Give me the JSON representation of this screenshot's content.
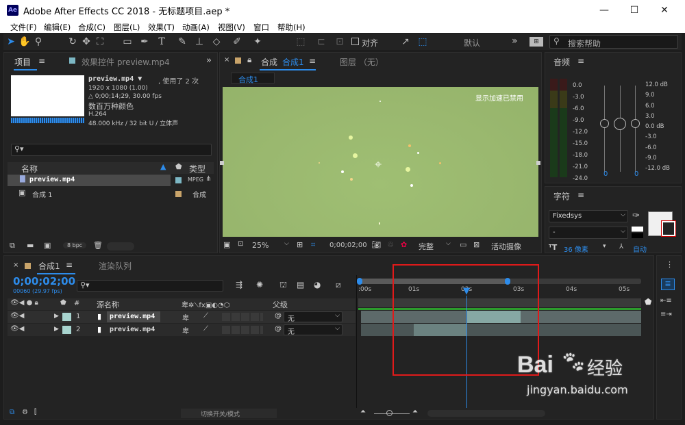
{
  "window": {
    "app_badge": "Ae",
    "title": "Adobe After Effects CC 2018 - 无标题项目.aep *",
    "min": "—",
    "max": "☐",
    "close": "✕"
  },
  "menu": [
    "文件(F)",
    "编辑(E)",
    "合成(C)",
    "图层(L)",
    "效果(T)",
    "动画(A)",
    "视图(V)",
    "窗口",
    "帮助(H)"
  ],
  "toolbar": {
    "snap_label": "对齐",
    "workspace": "默认",
    "search_placeholder": "搜索帮助",
    "more": "»"
  },
  "project": {
    "tab": "项目",
    "effects_tab": "效果控件 preview.mp4",
    "file_name": "preview.mp4 ▼",
    "used": ", 使用了 2 次",
    "resolution": "1920 x 1080 (1.00)",
    "duration": "△ 0;00;14;29, 30.00 fps",
    "colors": "数百万种颜色",
    "codec": "H.264",
    "audio": "48.000 kHz / 32 bit U / 立体声",
    "col_name": "名称",
    "col_type": "类型",
    "items": [
      {
        "name": "preview.mp4",
        "type": "MPEG"
      },
      {
        "name": "合成 1",
        "type": "合成"
      }
    ],
    "bpc": "8 bpc"
  },
  "comp": {
    "tab_prefix": "合成",
    "tab_name": "合成1",
    "layer_tab": "图层 （无）",
    "flow": "合成1",
    "accel_msg": "显示加速已禁用",
    "zoom": "25%",
    "timecode": "0;00;02;00",
    "quality": "完整",
    "camera": "活动摄像"
  },
  "audio": {
    "tab": "音频",
    "left": [
      "0.0",
      "-3.0",
      "-6.0",
      "-9.0",
      "-12.0",
      "-15.0",
      "-18.0",
      "-21.0",
      "-24.0"
    ],
    "right": [
      "12.0 dB",
      "9.0",
      "6.0",
      "3.0",
      "0.0 dB",
      "-3.0",
      "-6.0",
      "-9.0",
      "-12.0 dB"
    ],
    "val_l": "0",
    "val_r": "0"
  },
  "character": {
    "tab": "字符",
    "font": "Fixedsys",
    "style": "-",
    "size": "36 像素",
    "auto": "自动"
  },
  "timeline": {
    "close": "×",
    "comp_tab": "合成1",
    "render_tab": "渲染队列",
    "timecode": "0;00;02;00",
    "frames": "00060 (29.97 fps)",
    "col_num": "#",
    "col_name": "源名称",
    "col_parent": "父级",
    "layers": [
      {
        "num": "1",
        "name": "preview.mp4",
        "parent": "无"
      },
      {
        "num": "2",
        "name": "preview.mp4",
        "parent": "无"
      }
    ],
    "ruler": [
      ":00s",
      "01s",
      "02s",
      "03s",
      "04s",
      "05s"
    ],
    "toggle_label": "切换开关/模式"
  },
  "watermark": {
    "brand": "Bai",
    "brand2": "经验",
    "url": "jingyan.baidu.com"
  }
}
